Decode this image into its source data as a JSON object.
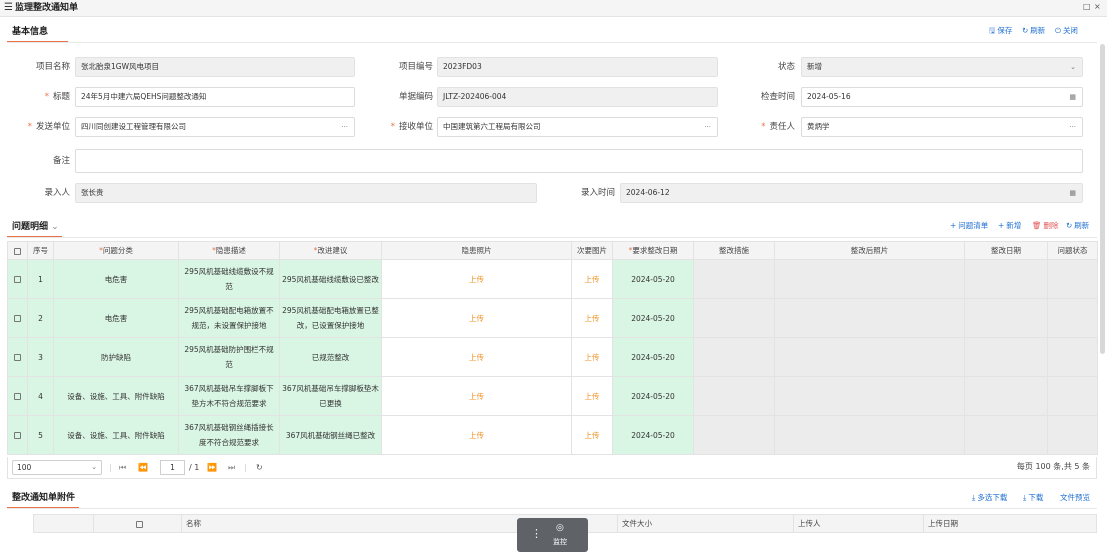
{
  "window": {
    "title": "监理整改通知单",
    "menu_icon": "menu-icon",
    "controls": [
      "□",
      "×"
    ]
  },
  "basic_info": {
    "title": "基本信息",
    "actions": {
      "save": "保存",
      "refresh": "刷新",
      "close": "关闭"
    },
    "fields": {
      "project_name": {
        "label": "项目名称",
        "value": "张北胎泉1GW风电项目"
      },
      "project_code": {
        "label": "项目编号",
        "value": "2023FD03"
      },
      "status": {
        "label": "状态",
        "value": "新增"
      },
      "subject": {
        "label": "标题",
        "value": "24年5月中建六局QEHS问题整改通知"
      },
      "doc_no": {
        "label": "单据编码",
        "value": "JLTZ-202406-004"
      },
      "check_time": {
        "label": "检查时间",
        "value": "2024-05-16"
      },
      "sender": {
        "label": "发送单位",
        "value": "四川同创建设工程管理有限公司"
      },
      "receiver": {
        "label": "接收单位",
        "value": "中国建筑第六工程局有限公司"
      },
      "owner": {
        "label": "责任人",
        "value": "黄炳学"
      },
      "remark": {
        "label": "备注",
        "value": ""
      },
      "entered_by": {
        "label": "录入人",
        "value": "张长贵"
      },
      "entered_time": {
        "label": "录入时间",
        "value": "2024-06-12"
      }
    },
    "ellipsis": "···",
    "calendar_icon": "calendar-icon",
    "chevron": "⌄"
  },
  "issues": {
    "title": "问题明细",
    "collapse_icon": "⌄",
    "actions": {
      "checklist": "问题清单",
      "add": "新增",
      "delete": "删除",
      "refresh": "刷新"
    },
    "columns": [
      "",
      "序号",
      "问题分类",
      "隐患描述",
      "改进建议",
      "隐患照片",
      "次要图片",
      "要求整改日期",
      "整改措施",
      "整改后照片",
      "整改日期",
      "问题状态"
    ],
    "required_columns": [
      2,
      3,
      4,
      7
    ],
    "upload_text": "上传",
    "rows": [
      {
        "no": "1",
        "category": "电危害",
        "desc": "295风机基础线缆敷设不规范",
        "advice": "295风机基础线缆敷设已整改",
        "due": "2024-05-20"
      },
      {
        "no": "2",
        "category": "电危害",
        "desc": "295风机基础配电箱放置不规范，未设置保护接地",
        "advice": "295风机基础配电箱放置已整改，已设置保护接地",
        "due": "2024-05-20"
      },
      {
        "no": "3",
        "category": "防护缺陷",
        "desc": "295风机基础防护围栏不规范",
        "advice": "已规范整改",
        "due": "2024-05-20"
      },
      {
        "no": "4",
        "category": "设备、设施、工具、附件缺陷",
        "desc": "367风机基础吊车撑脚板下垫方木不符合规范要求",
        "advice": "367风机基础吊车撑脚板垫木已更换",
        "due": "2024-05-20"
      },
      {
        "no": "5",
        "category": "设备、设施、工具、附件缺陷",
        "desc": "367风机基础钢丝绳插接长度不符合规范要求",
        "advice": "367风机基础钢丝绳已整改",
        "due": "2024-05-20"
      }
    ],
    "pager": {
      "page_size": "100",
      "current_page": "1",
      "total_pages": "/ 1",
      "summary": "每页 100 条,共 5 条"
    }
  },
  "attachments": {
    "title": "整改通知单附件",
    "actions": {
      "multi_download": "多选下载",
      "download": "下载",
      "preview": "文件预览"
    },
    "columns": [
      "",
      "名称",
      "文件大小",
      "上传人",
      "上传日期"
    ]
  },
  "monitor": {
    "label": "监控"
  },
  "colors": {
    "accent": "#e8734b",
    "link": "#1f6fd1",
    "danger": "#e25252",
    "upload": "#f29023",
    "row_green": "#d9f5e3"
  }
}
